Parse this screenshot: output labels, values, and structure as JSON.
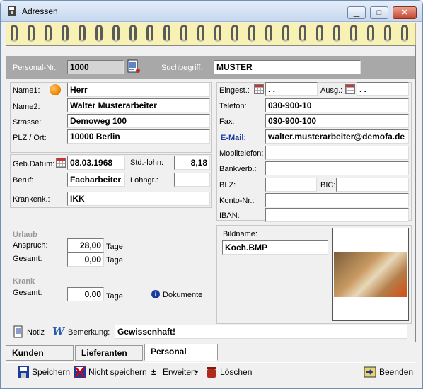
{
  "window": {
    "title": "Adressen",
    "btn_min": "▁",
    "btn_max": "□",
    "btn_close": "✕"
  },
  "header": {
    "personal_nr_label": "Personal-Nr.:",
    "personal_nr": "1000",
    "suchbegriff_label": "Suchbegriff:",
    "suchbegriff": "MUSTER"
  },
  "left": {
    "name1_label": "Name1:",
    "name1": "Herr",
    "name2_label": "Name2:",
    "name2": "Walter Musterarbeiter",
    "strasse_label": "Strasse:",
    "strasse": "Demoweg 100",
    "plz_label": "PLZ / Ort:",
    "plz_ort": "10000 Berlin",
    "geb_label": "Geb.Datum:",
    "geb": "08.03.1968",
    "std_label": "Std.-lohn:",
    "std": "8,18",
    "beruf_label": "Beruf:",
    "beruf": "Facharbeiter",
    "lohngr_label": "Lohngr.:",
    "lohngr": "",
    "krankenk_label": "Krankenk.:",
    "krankenk": "IKK"
  },
  "urlaub": {
    "title": "Urlaub",
    "anspruch_label": "Anspruch:",
    "anspruch": "28,00",
    "gesamt_label": "Gesamt:",
    "gesamt": "0,00",
    "unit": "Tage"
  },
  "krank": {
    "title": "Krank",
    "gesamt_label": "Gesamt:",
    "gesamt": "0,00",
    "unit": "Tage",
    "dokumente": "Dokumente"
  },
  "right": {
    "eingest_label": "Eingest.:",
    "eingest": " .  .",
    "ausg_label": "Ausg.:",
    "ausg": " .  .",
    "telefon_label": "Telefon:",
    "telefon": "030-900-10",
    "fax_label": "Fax:",
    "fax": "030-900-100",
    "email_label": "E-Mail:",
    "email": "walter.musterarbeiter@demofa.de",
    "mobil_label": "Mobiltelefon:",
    "mobil": "",
    "bank_label": "Bankverb.:",
    "bank": "",
    "blz_label": "BLZ:",
    "blz": "",
    "bic_label": "BIC:",
    "bic": "",
    "konto_label": "Konto-Nr.:",
    "konto": "",
    "iban_label": "IBAN:",
    "iban": ""
  },
  "bild": {
    "label": "Bildname:",
    "name": "Koch.BMP"
  },
  "bottom": {
    "notiz": "Notiz",
    "bemerkung_label": "Bemerkung:",
    "bemerkung": "Gewissenhaft!"
  },
  "tabs": [
    "Kunden",
    "Lieferanten",
    "Personal"
  ],
  "toolbar": {
    "speichern": "Speichern",
    "nicht_speichern": "Nicht speichern",
    "erweitert": "Erweitert",
    "loeschen": "Löschen",
    "beenden": "Beenden"
  },
  "colors": {
    "accent": "#1a3ca0",
    "header_bar": "#a8a8a8",
    "notebook": "#f7f2b4"
  }
}
